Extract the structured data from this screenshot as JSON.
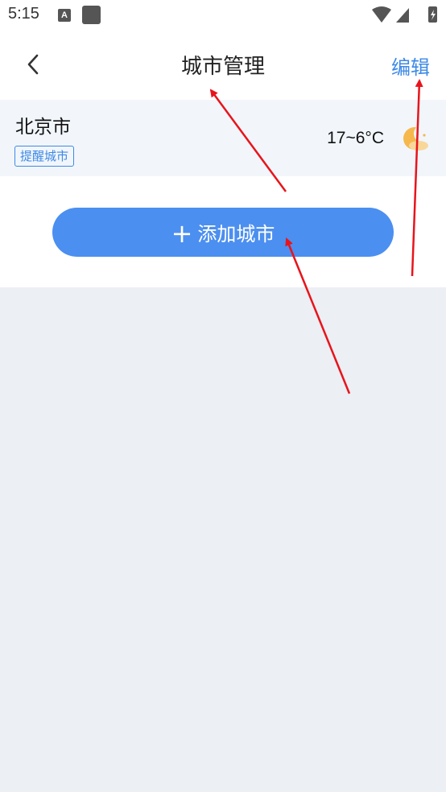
{
  "status": {
    "time": "5:15",
    "icon_a": "A"
  },
  "header": {
    "title": "城市管理",
    "edit_label": "编辑",
    "back_icon": "chevron-left-icon"
  },
  "city": {
    "name": "北京市",
    "tag": "提醒城市",
    "temperature": "17~6°C",
    "weather_icon": "moon-cloud-icon"
  },
  "actions": {
    "add_plus": "+",
    "add_label": "添加城市"
  },
  "colors": {
    "accent": "#3d8ae6",
    "button": "#4b8ff0",
    "card_bg": "#f2f6fb",
    "page_bg": "#eceff4",
    "annotation": "#e8141b"
  }
}
